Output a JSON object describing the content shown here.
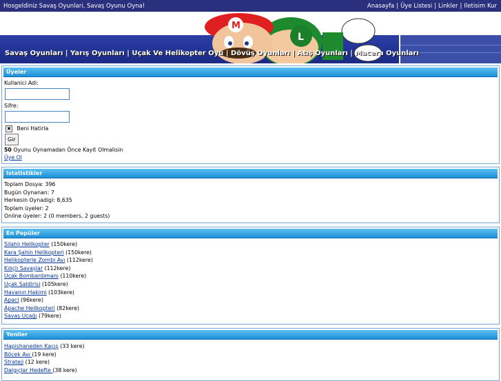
{
  "topbar": {
    "welcome": "Hosgeldiniz Savaş Oyunlari, Savaş Oyunu Oyna!",
    "links": [
      "Anasayfa",
      "Üye Listesi",
      "Linkler",
      "Iletisim Kur"
    ]
  },
  "menu": [
    "Savaş Oyunları",
    "Yarış Oyunları",
    "Uçak Ve Helikopter Oyu",
    "Dövüş Oyunları",
    "Atış Oyunları",
    "Macera Oyunları"
  ],
  "uyeler": {
    "title": "Üyeler",
    "username_label": "Kullanici Adi:",
    "password_label": "Sifre:",
    "remember_label": "Beni Hatirla",
    "login_button": "Gir",
    "notice_count": "50",
    "notice_text": " Oyunu Oynamadan Önce Kayit Olmalisin",
    "register_link": "Üye Ol"
  },
  "istatistikler": {
    "title": "Istatistikler",
    "lines": [
      "Toplam Dosya: 396",
      "Bugün Oynanan: 7",
      "Herkesin Oynadigi: 8,635",
      "Toplam üyeler: 2",
      "Online üyeler: 2 (0 members, 2 guests)"
    ]
  },
  "populer": {
    "title": "En Popüler",
    "items": [
      {
        "name": "Silahlı Helikopter",
        "count": " (150kere)"
      },
      {
        "name": "Kara Şahin Helikopteri",
        "count": " (150kere)"
      },
      {
        "name": "Helikopterle Zombi Avı",
        "count": " (112kere)"
      },
      {
        "name": "Kılıçlı Savaşlar",
        "count": " (112kere)"
      },
      {
        "name": "Uçak Bombardımanı",
        "count": " (110kere)"
      },
      {
        "name": "Uçak Saldirisi",
        "count": " (105kere)"
      },
      {
        "name": "Havanın Hakimi",
        "count": " (103kere)"
      },
      {
        "name": "Apaci",
        "count": " (96kere)"
      },
      {
        "name": "Apache Helikopteri",
        "count": " (82kere)"
      },
      {
        "name": "Savaş Uçağı",
        "count": " (79kere)"
      }
    ]
  },
  "yeniler": {
    "title": "Yeniler",
    "items": [
      {
        "name": "Hapishaneden Kaçış",
        "count": " (33 kere)"
      },
      {
        "name": "Böcek Avı ",
        "count": "(19 kere)"
      },
      {
        "name": "Strateji",
        "count": " (12 kere)"
      },
      {
        "name": "Dalgıçlar Hedefte ",
        "count": "(38 kere)"
      }
    ]
  }
}
